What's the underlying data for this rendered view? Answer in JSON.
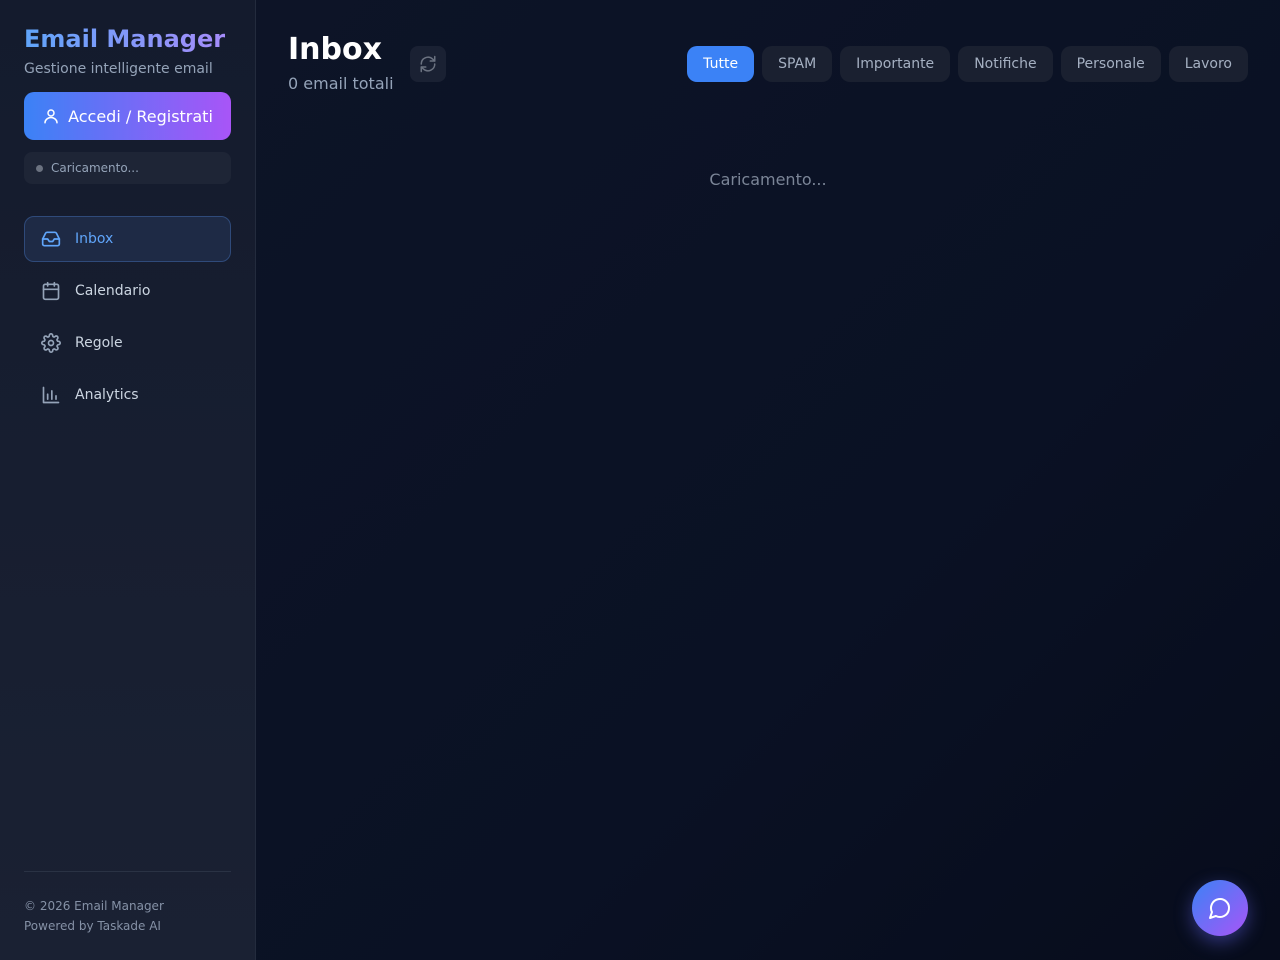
{
  "sidebar": {
    "brand_title": "Email Manager",
    "brand_subtitle": "Gestione intelligente email",
    "login_label": "Accedi / Registrati",
    "status_text": "Caricamento...",
    "nav": [
      {
        "label": "Inbox",
        "icon": "inbox-icon",
        "active": true
      },
      {
        "label": "Calendario",
        "icon": "calendar-icon",
        "active": false
      },
      {
        "label": "Regole",
        "icon": "gear-icon",
        "active": false
      },
      {
        "label": "Analytics",
        "icon": "bar-chart-icon",
        "active": false
      }
    ],
    "footer_copyright": "© 2026 Email Manager",
    "footer_powered": "Powered by Taskade AI"
  },
  "main": {
    "title": "Inbox",
    "subtitle": "0 email totali",
    "filters": [
      {
        "label": "Tutte",
        "active": true
      },
      {
        "label": "SPAM",
        "active": false
      },
      {
        "label": "Importante",
        "active": false
      },
      {
        "label": "Notifiche",
        "active": false
      },
      {
        "label": "Personale",
        "active": false
      },
      {
        "label": "Lavoro",
        "active": false
      }
    ],
    "loading_text": "Caricamento..."
  },
  "colors": {
    "accent": "#3b82f6",
    "accent_secondary": "#a855f7",
    "background": "#0b1120"
  }
}
